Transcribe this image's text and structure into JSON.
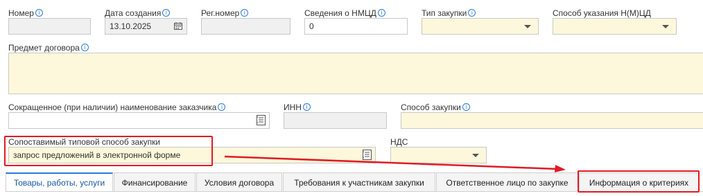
{
  "fields": {
    "number": {
      "label": "Номер",
      "value": ""
    },
    "created": {
      "label": "Дата создания",
      "value": "13.10.2025"
    },
    "reg_number": {
      "label": "Рег.номер",
      "value": ""
    },
    "nmcd_info": {
      "label": "Сведения о НМЦД",
      "value": "0"
    },
    "purchase_type": {
      "label": "Тип закупки",
      "value": ""
    },
    "nmcd_method": {
      "label": "Способ указания Н(М)ЦД",
      "value": ""
    },
    "subject": {
      "label": "Предмет договора",
      "value": ""
    },
    "customer_short_name": {
      "label": "Сокращенное (при наличии) наименование заказчика",
      "value": ""
    },
    "inn": {
      "label": "ИНН",
      "value": ""
    },
    "purchase_method": {
      "label": "Способ закупки",
      "value": ""
    },
    "typical_method": {
      "label": "Сопоставимый типовой способ закупки",
      "value": "запрос предложений в электронной форме"
    },
    "vat": {
      "label": "НДС",
      "value": ""
    }
  },
  "tabs": [
    {
      "label": "Товары, работы, услуги",
      "active": true
    },
    {
      "label": "Финансирование",
      "active": false
    },
    {
      "label": "Условия договора",
      "active": false
    },
    {
      "label": "Требования к участникам закупки",
      "active": false
    },
    {
      "label": "Ответственное лицо по закупке",
      "active": false
    },
    {
      "label": "Информация о критериях",
      "active": false
    }
  ],
  "colors": {
    "highlight": "#e01b24",
    "required_field": "#fdf8db",
    "readonly_field": "#f0f0f0",
    "accent": "#2c7bd8"
  },
  "icons": {
    "info": "info-icon",
    "calendar": "calendar-icon",
    "dictionary": "dictionary-icon",
    "dropdown": "chevron-down-icon"
  }
}
